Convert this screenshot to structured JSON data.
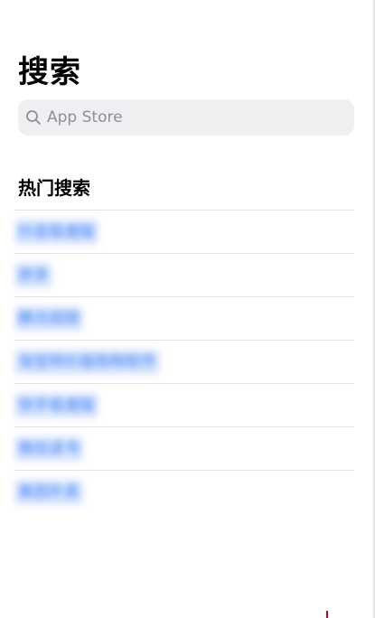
{
  "header": {
    "title": "搜索"
  },
  "search": {
    "placeholder": "App Store",
    "value": ""
  },
  "trending": {
    "title": "热门搜索",
    "items": [
      {
        "label": "抖音极速版"
      },
      {
        "label": "拼多"
      },
      {
        "label": "腾讯视频"
      },
      {
        "label": "淘宝特价版购物软件"
      },
      {
        "label": "快手极速版"
      },
      {
        "label": "微信读书"
      },
      {
        "label": "美团外卖"
      }
    ]
  },
  "colors": {
    "link": "#3478f6",
    "search_bg": "#efeff2",
    "placeholder": "#8e8e93",
    "separator": "#e3e3e6"
  }
}
